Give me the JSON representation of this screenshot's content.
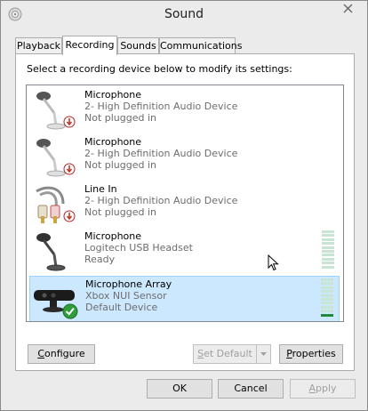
{
  "window": {
    "title": "Sound"
  },
  "tabs": [
    {
      "label": "Playback"
    },
    {
      "label": "Recording"
    },
    {
      "label": "Sounds"
    },
    {
      "label": "Communications"
    }
  ],
  "instruction": "Select a recording device below to modify its settings:",
  "devices": [
    {
      "name": "Microphone",
      "driver": "2- High Definition Audio Device",
      "status": "Not plugged in",
      "icon": "microphone-icon",
      "badge": "unplugged-down-arrow"
    },
    {
      "name": "Microphone",
      "driver": "2- High Definition Audio Device",
      "status": "Not plugged in",
      "icon": "microphone-icon",
      "badge": "unplugged-down-arrow"
    },
    {
      "name": "Line In",
      "driver": "2- High Definition Audio Device",
      "status": "Not plugged in",
      "icon": "line-in-cable-icon",
      "badge": "unplugged-down-arrow"
    },
    {
      "name": "Microphone",
      "driver": "Logitech USB Headset",
      "status": "Ready",
      "icon": "microphone-icon",
      "level": 0.0
    },
    {
      "name": "Microphone Array",
      "driver": "Xbox NUI Sensor",
      "status": "Default Device",
      "icon": "kinect-sensor-icon",
      "badge": "default-check",
      "level": 0.1,
      "selected": true
    }
  ],
  "buttons": {
    "configure": {
      "label": "Configure",
      "accel": "C",
      "rest": "onfigure"
    },
    "set_default": {
      "label": "Set Default",
      "accel": "S",
      "rest": "et Default"
    },
    "properties": {
      "label": "Properties",
      "accel": "P",
      "rest": "roperties"
    },
    "ok": "OK",
    "cancel": "Cancel",
    "apply": {
      "label": "Apply",
      "accel": "A",
      "rest": "pply"
    }
  },
  "colors": {
    "selection": "#cce8ff",
    "meter_active": "#1f8a3b",
    "meter_idle": "#c8e4d4",
    "unplugged_badge": "#c0392b",
    "default_badge": "#2f9e3a"
  }
}
